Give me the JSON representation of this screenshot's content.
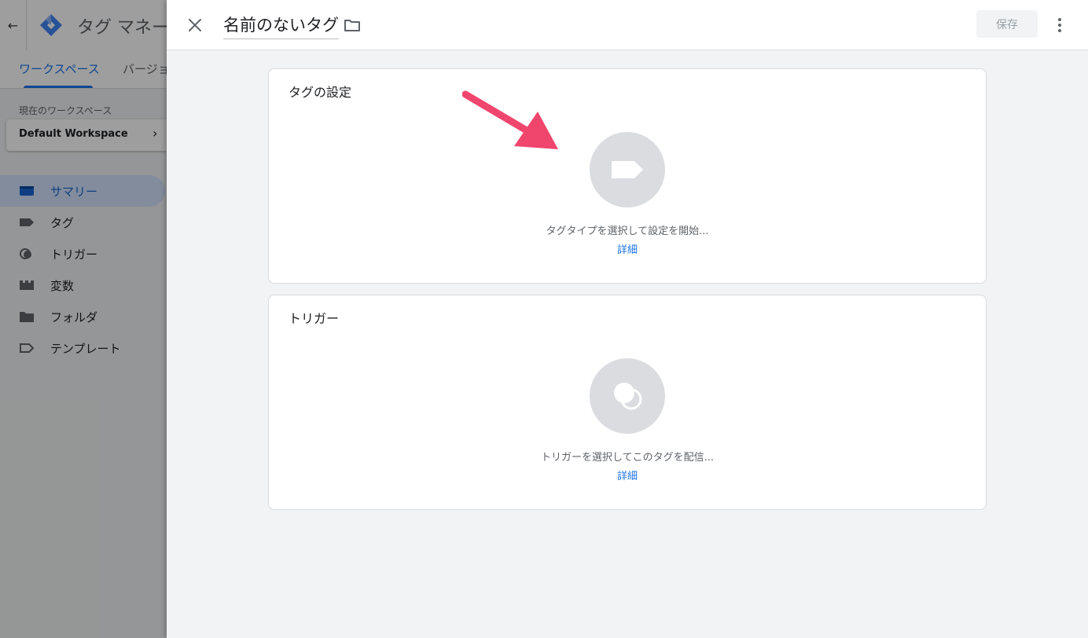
{
  "app": {
    "title": "タグ マネー",
    "tabs": [
      {
        "label": "ワークスペース",
        "active": true
      },
      {
        "label": "バージョ",
        "active": false
      }
    ],
    "workspace_label": "現在のワークスペース",
    "workspace_name": "Default Workspace",
    "nav": [
      {
        "label": "サマリー",
        "icon": "summary-icon",
        "active": true
      },
      {
        "label": "タグ",
        "icon": "tag-icon",
        "active": false
      },
      {
        "label": "トリガー",
        "icon": "trigger-icon",
        "active": false
      },
      {
        "label": "変数",
        "icon": "variables-icon",
        "active": false
      },
      {
        "label": "フォルダ",
        "icon": "folder-icon",
        "active": false
      },
      {
        "label": "テンプレート",
        "icon": "template-icon",
        "active": false
      }
    ]
  },
  "editor": {
    "tag_name": "名前のないタグ",
    "save_label": "保存",
    "tag_config": {
      "title": "タグの設定",
      "hint": "タグタイプを選択して設定を開始...",
      "link": "詳細"
    },
    "triggering": {
      "title": "トリガー",
      "hint": "トリガーを選択してこのタグを配信...",
      "link": "詳細"
    }
  },
  "colors": {
    "accent": "#1a73e8",
    "annotation_arrow": "#f0466e",
    "placeholder_circle": "#dadce0"
  }
}
